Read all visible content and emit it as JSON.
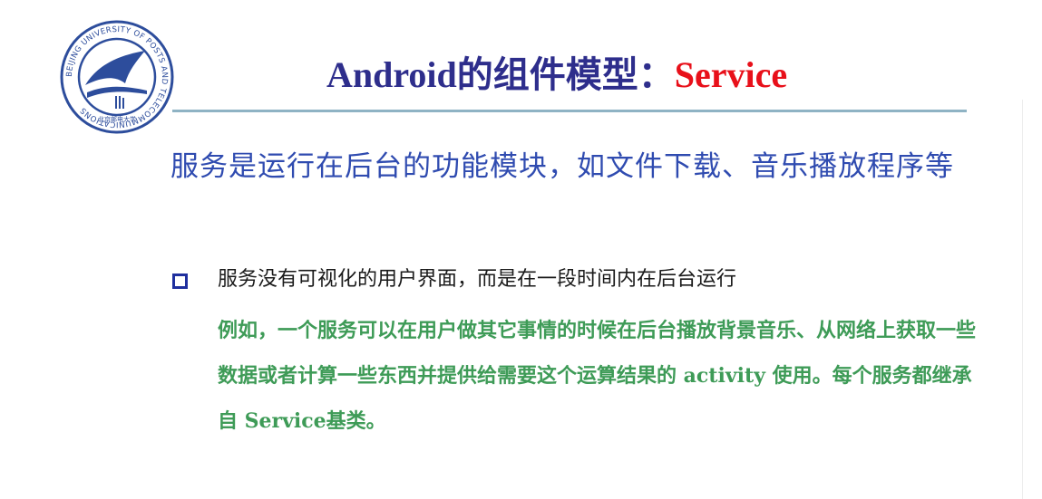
{
  "slide": {
    "title_main": "Android的组件模型：",
    "title_accent": "Service",
    "intro": "服务是运行在后台的功能模块，如文件下载、音乐播放程序等",
    "bullet": "服务没有可视化的用户界面，而是在一段时间内在后台运行",
    "example": "例如，一个服务可以在用户做其它事情的时候在后台播放背景音乐、从网络上获取一些数据或者计算一些东西并提供给需要这个运算结果的 activity 使用。每个服务都继承自 Service基类。"
  },
  "logo": {
    "icon": "university-seal-icon",
    "ring_text": "BEIJING UNIVERSITY OF POSTS AND TELECOMMUNICATIONS",
    "inner_text": "北京邮电大学"
  },
  "colors": {
    "title": "#2e2e8c",
    "accent": "#e8101a",
    "intro": "#2f4bb0",
    "bullet_box": "#1f2f9e",
    "example": "#3e9b57",
    "rule": "#8fb3c4"
  }
}
